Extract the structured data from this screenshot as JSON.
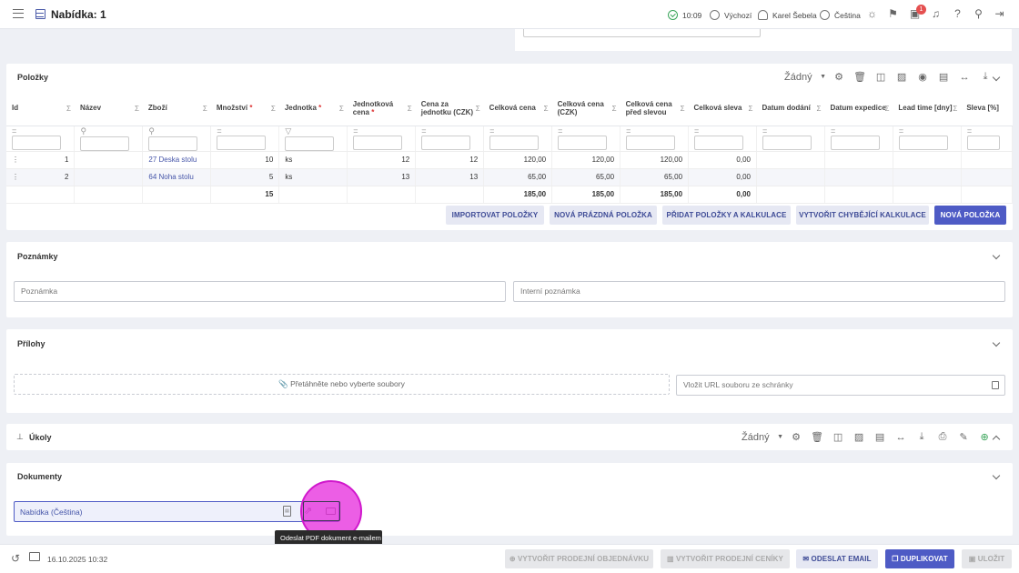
{
  "topbar": {
    "title": "Nabídka: 1",
    "time": "10:09",
    "workspace": "Výchozí",
    "user": "Karel Šebela",
    "language": "Čeština",
    "notifications_count": "1"
  },
  "items_panel": {
    "title": "Položky",
    "view_select": "Žádný",
    "columns": [
      "Id",
      "Název",
      "Zboží",
      "Množství",
      "Jednotka",
      "Jednotková cena",
      "Cena za jednotku (CZK)",
      "Celková cena",
      "Celková cena (CZK)",
      "Celková cena před slevou",
      "Celková sleva",
      "Datum dodání",
      "Datum expedice",
      "Lead time [dny]",
      "Sleva [%]"
    ],
    "rows": [
      {
        "id": "1",
        "name": "",
        "product": "27 Deska stolu",
        "qty": "10",
        "unit": "ks",
        "unit_price": "12",
        "unit_price_czk": "12",
        "total": "120,00",
        "total_czk": "120,00",
        "total_before": "120,00",
        "discount": "0,00"
      },
      {
        "id": "2",
        "name": "",
        "product": "64 Noha stolu",
        "qty": "5",
        "unit": "ks",
        "unit_price": "13",
        "unit_price_czk": "13",
        "total": "65,00",
        "total_czk": "65,00",
        "total_before": "65,00",
        "discount": "0,00"
      }
    ],
    "sums": {
      "qty": "15",
      "total": "185,00",
      "total_czk": "185,00",
      "total_before": "185,00",
      "discount": "0,00"
    },
    "buttons": {
      "import": "IMPORTOVAT POLOŽKY",
      "new_empty": "NOVÁ PRÁZDNÁ POLOŽKA",
      "add_calc": "PŘIDAT POLOŽKY A KALKULACE",
      "create_missing": "VYTVOŘIT CHYBĚJÍCÍ KALKULACE",
      "new_item": "NOVÁ POLOŽKA"
    }
  },
  "notes_panel": {
    "title": "Poznámky",
    "note_placeholder": "Poznámka",
    "internal_placeholder": "Interní poznámka"
  },
  "attachments_panel": {
    "title": "Přílohy",
    "drop_text": "Přetáhněte nebo vyberte soubory",
    "url_placeholder": "Vložit URL souboru ze schránky"
  },
  "tasks_panel": {
    "title": "Úkoly",
    "view_select": "Žádný"
  },
  "documents_panel": {
    "title": "Dokumenty",
    "doc_name": "Nabídka (Čeština)",
    "tooltip": "Odeslat PDF dokument e-mailem"
  },
  "bottombar": {
    "date": "16.10.2025 10:32",
    "create_order": "VYTVOŘIT PRODEJNÍ OBJEDNÁVKU",
    "create_pricelist": "VYTVOŘIT PRODEJNÍ CENÍKY",
    "send_email": "ODESLAT EMAIL",
    "duplicate": "DUPLIKOVAT",
    "save": "ULOŽIT"
  }
}
